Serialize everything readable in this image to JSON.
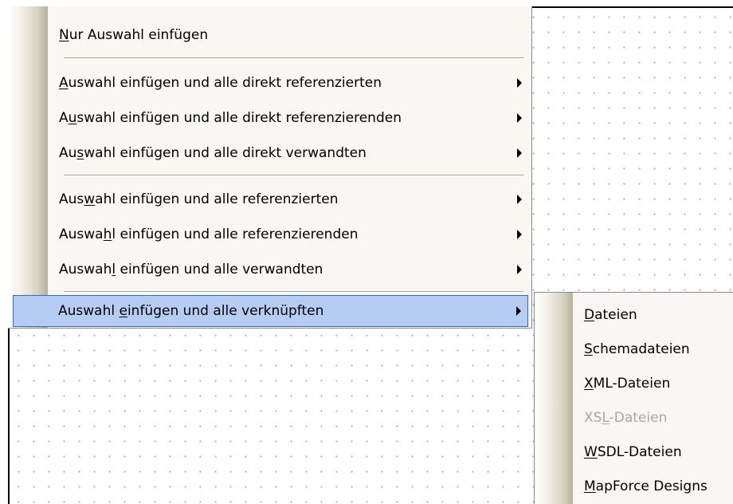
{
  "main_menu": {
    "items": [
      {
        "pre": "",
        "acc": "N",
        "post": "ur Auswahl einfügen",
        "submenu": false
      },
      {
        "pre": "",
        "acc": "A",
        "post": "uswahl einfügen und alle direkt referenzierten",
        "submenu": true
      },
      {
        "pre": "A",
        "acc": "u",
        "post": "swahl einfügen und alle direkt referenzierenden",
        "submenu": true
      },
      {
        "pre": "Au",
        "acc": "s",
        "post": "wahl einfügen und alle direkt verwandten",
        "submenu": true
      },
      {
        "pre": "Aus",
        "acc": "w",
        "post": "ahl einfügen und alle referenzierten",
        "submenu": true
      },
      {
        "pre": "Auswa",
        "acc": "h",
        "post": "l einfügen und alle referenzierenden",
        "submenu": true
      },
      {
        "pre": "Auswah",
        "acc": "l",
        "post": " einfügen und alle verwandten",
        "submenu": true
      },
      {
        "pre": "Auswahl ",
        "acc": "e",
        "post": "infügen und alle verknüpften",
        "submenu": true,
        "highlighted": true
      }
    ]
  },
  "sub_menu": {
    "items": [
      {
        "pre": "",
        "acc": "D",
        "post": "ateien",
        "enabled": true
      },
      {
        "pre": "",
        "acc": "S",
        "post": "chemadateien",
        "enabled": true
      },
      {
        "pre": "",
        "acc": "X",
        "post": "ML-Dateien",
        "enabled": true
      },
      {
        "pre": "XS",
        "acc": "L",
        "post": "-Dateien",
        "enabled": false
      },
      {
        "pre": "",
        "acc": "W",
        "post": "SDL-Dateien",
        "enabled": true
      },
      {
        "pre": "",
        "acc": "M",
        "post": "apForce Designs",
        "enabled": true
      }
    ]
  },
  "colors": {
    "menu_background": "#f8f7f3",
    "highlight_fill": "#b6cdf3",
    "highlight_border": "#316ac5",
    "disabled_text": "#a8a7a1"
  }
}
